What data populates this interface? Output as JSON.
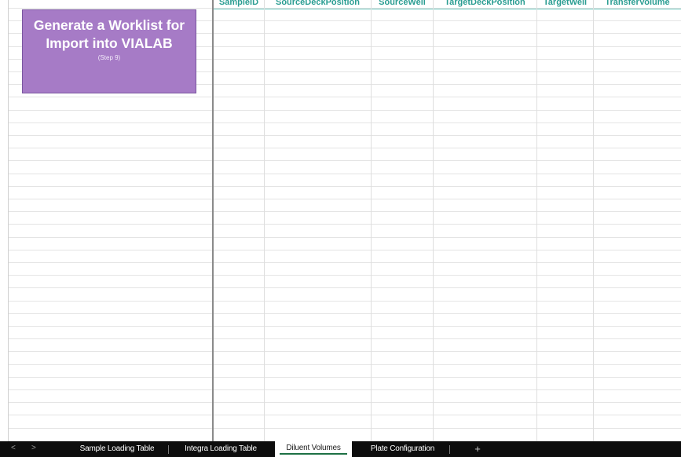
{
  "columns": [
    "SampleID",
    "SourceDeckPosition",
    "SourceWell",
    "TargetDeckPosition",
    "TargetWell",
    "TransferVolume"
  ],
  "macro_button": {
    "title": "Generate a Worklist for Import into VIALAB",
    "subtitle": "(Step 9)",
    "color": "#a67bc6"
  },
  "tabs": [
    {
      "label": "Sample Loading Table",
      "active": false
    },
    {
      "label": "Integra Loading Table",
      "active": false
    },
    {
      "label": "Diluent Volumes",
      "active": true
    },
    {
      "label": "Plate Configuration",
      "active": false
    }
  ],
  "nav": {
    "prev": "<",
    "next": ">",
    "add": "+"
  },
  "header_color": "#2a9d92"
}
